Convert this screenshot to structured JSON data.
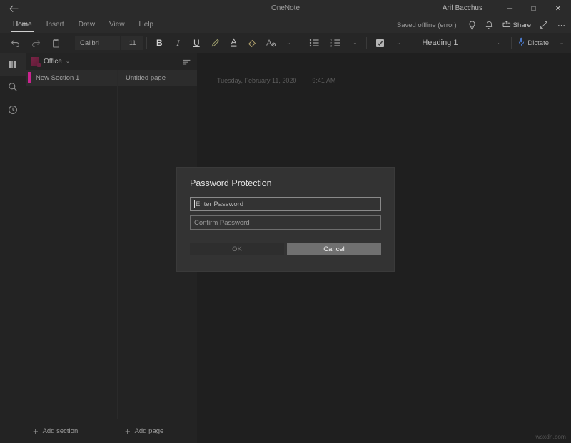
{
  "window": {
    "title": "OneNote",
    "user": "Arif Bacchus",
    "back_icon": "back-arrow-icon",
    "minimize_label": "─",
    "maximize_label": "□",
    "close_label": "✕"
  },
  "ribbon_tabs": {
    "items": [
      {
        "label": "Home",
        "active": true
      },
      {
        "label": "Insert",
        "active": false
      },
      {
        "label": "Draw",
        "active": false
      },
      {
        "label": "View",
        "active": false
      },
      {
        "label": "Help",
        "active": false
      }
    ],
    "status": "Saved offline (error)",
    "share_label": "Share",
    "more_label": "⋯",
    "icons": [
      "lightbulb-icon",
      "bell-icon",
      "share-icon",
      "expand-icon",
      "more-options-icon"
    ]
  },
  "toolbar": {
    "undo_icon": "undo-icon",
    "redo_icon": "redo-icon",
    "clipboard_icon": "clipboard-icon",
    "font_name": "Calibri",
    "font_size": "11",
    "bold_label": "B",
    "italic_label": "I",
    "underline_label": "U",
    "highlighter_icon": "highlighter-icon",
    "font_color_icon": "font-color-icon",
    "ink_color_icon": "ink-color-icon",
    "clear_format_icon": "clear-formatting-icon",
    "bullets_icon": "bulleted-list-icon",
    "numbering_icon": "numbered-list-icon",
    "todo_icon": "todo-checkbox-icon",
    "style_name": "Heading 1",
    "dictate_label": "Dictate",
    "dictate_icon": "microphone-icon",
    "caret_glyph": "⌄"
  },
  "rail": {
    "items": [
      {
        "name": "notebooks-icon",
        "active": true
      },
      {
        "name": "search-icon",
        "active": false
      },
      {
        "name": "recent-icon",
        "active": false
      }
    ]
  },
  "notebook": {
    "name": "Office",
    "caret_glyph": "⌄",
    "sort_icon": "sort-icon"
  },
  "sections": {
    "items": [
      {
        "label": "New Section 1",
        "color": "#c9248f"
      }
    ],
    "add_label": "Add section",
    "add_icon": "plus-icon"
  },
  "pages": {
    "items": [
      {
        "label": "Untitled page"
      }
    ],
    "add_label": "Add page",
    "add_icon": "plus-icon"
  },
  "canvas": {
    "date": "Tuesday, February 11, 2020",
    "time": "9:41 AM"
  },
  "dialog": {
    "title": "Password Protection",
    "enter_password_placeholder": "Enter Password",
    "confirm_password_placeholder": "Confirm Password",
    "ok_label": "OK",
    "cancel_label": "Cancel"
  },
  "watermark": {
    "text": "wsxdn.com"
  },
  "colors": {
    "accent_section": "#c9248f",
    "dialog_bg": "#333333",
    "cancel_button": "#707070",
    "app_bg": "#202020"
  }
}
